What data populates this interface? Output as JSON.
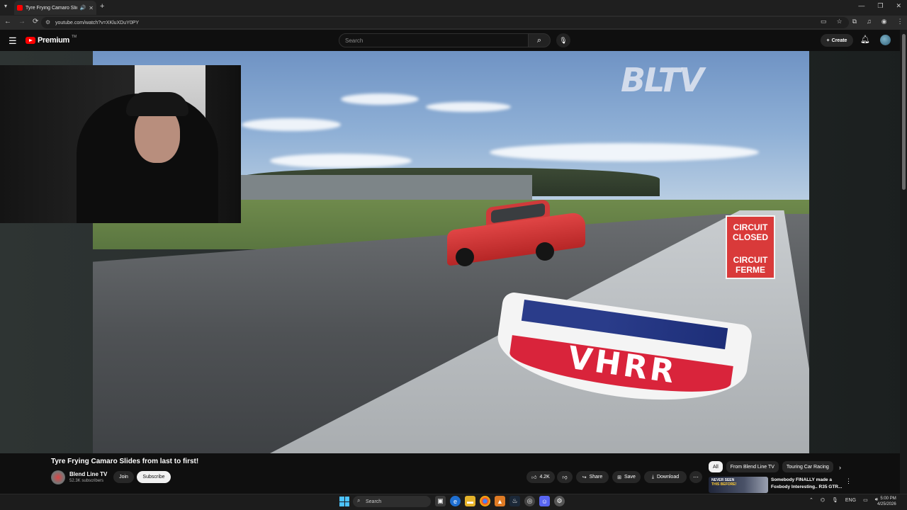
{
  "browser": {
    "tab_title": "Tyre Frying Camaro Slides f",
    "url": "youtube.com/watch?v=XKluXDuY0PY"
  },
  "youtube": {
    "logo_text": "Premium",
    "logo_tm": "TM",
    "search_placeholder": "Search",
    "create_label": "Create"
  },
  "video": {
    "watermark_left": "BLTV",
    "watermark_right": "",
    "sign_line1": "CIRCUIT CLOSED",
    "sign_line2": "CIRCUIT FERME",
    "badge_text": "VHRR",
    "title": "Tyre Frying Camaro Slides from last to first!"
  },
  "channel": {
    "name": "Blend Line TV",
    "subscribers": "52.3K subscribers",
    "join_label": "Join",
    "subscribe_label": "Subscribe"
  },
  "actions": {
    "likes": "4.2K",
    "share": "Share",
    "save": "Save",
    "download": "Download"
  },
  "sidebar": {
    "chips": [
      "All",
      "From Blend Line TV",
      "Touring Car Racing"
    ],
    "rec_thumb_line1": "NEVER SEEN",
    "rec_thumb_line2": "THIS BEFORE!",
    "rec_title": "Somebody FINALLY made a Foxbody Interesting.. R35 GTR..."
  },
  "taskbar": {
    "search_placeholder": "Search",
    "lang": "ENG",
    "time": "5:00 PM",
    "date": "4/25/2026"
  },
  "colors": {
    "youtube_red": "#ff0000",
    "background": "#0f0f0f",
    "accent_blue": "#4cc2ff"
  }
}
